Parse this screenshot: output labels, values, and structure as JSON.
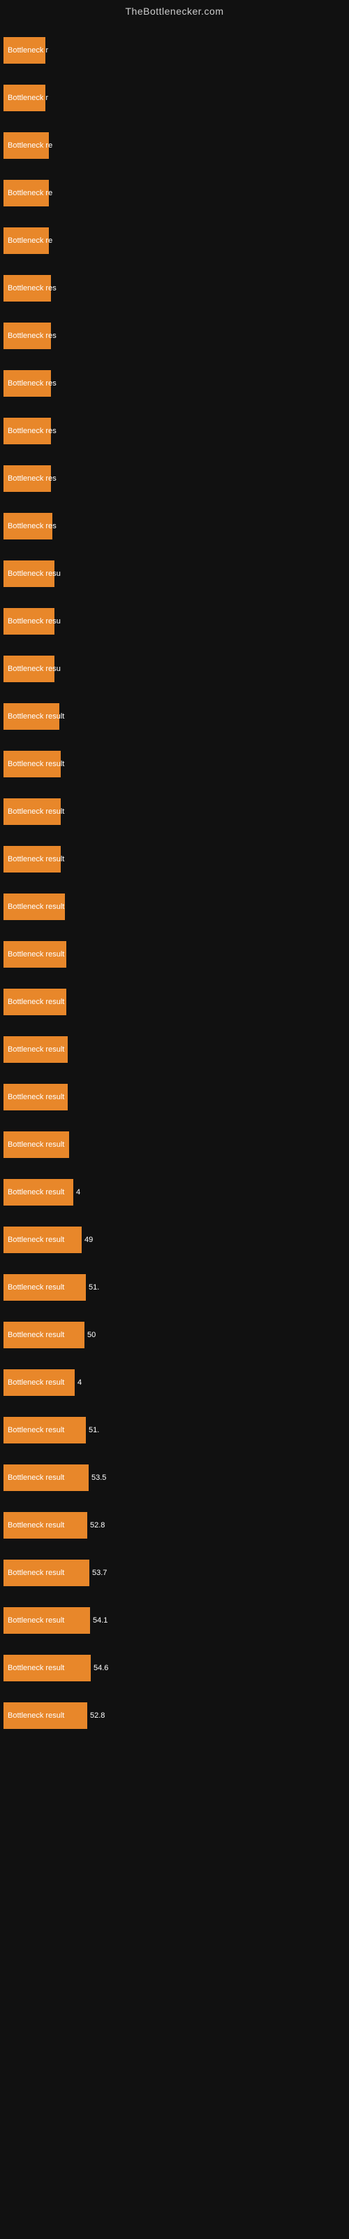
{
  "header": {
    "title": "TheBottlenecker.com"
  },
  "bars": [
    {
      "label": "Bottleneck r",
      "width": 60,
      "value": ""
    },
    {
      "label": "Bottleneck r",
      "width": 60,
      "value": ""
    },
    {
      "label": "Bottleneck re",
      "width": 65,
      "value": ""
    },
    {
      "label": "Bottleneck re",
      "width": 65,
      "value": ""
    },
    {
      "label": "Bottleneck re",
      "width": 65,
      "value": ""
    },
    {
      "label": "Bottleneck res",
      "width": 68,
      "value": ""
    },
    {
      "label": "Bottleneck res",
      "width": 68,
      "value": ""
    },
    {
      "label": "Bottleneck res",
      "width": 68,
      "value": ""
    },
    {
      "label": "Bottleneck res",
      "width": 68,
      "value": ""
    },
    {
      "label": "Bottleneck res",
      "width": 68,
      "value": ""
    },
    {
      "label": "Bottleneck res",
      "width": 70,
      "value": ""
    },
    {
      "label": "Bottleneck resu",
      "width": 73,
      "value": ""
    },
    {
      "label": "Bottleneck resu",
      "width": 73,
      "value": ""
    },
    {
      "label": "Bottleneck resu",
      "width": 73,
      "value": ""
    },
    {
      "label": "Bottleneck result",
      "width": 80,
      "value": ""
    },
    {
      "label": "Bottleneck result",
      "width": 82,
      "value": ""
    },
    {
      "label": "Bottleneck result",
      "width": 82,
      "value": ""
    },
    {
      "label": "Bottleneck result",
      "width": 82,
      "value": ""
    },
    {
      "label": "Bottleneck result",
      "width": 88,
      "value": ""
    },
    {
      "label": "Bottleneck result",
      "width": 90,
      "value": ""
    },
    {
      "label": "Bottleneck result",
      "width": 90,
      "value": ""
    },
    {
      "label": "Bottleneck result",
      "width": 92,
      "value": ""
    },
    {
      "label": "Bottleneck result",
      "width": 92,
      "value": ""
    },
    {
      "label": "Bottleneck result",
      "width": 94,
      "value": ""
    },
    {
      "label": "Bottleneck result",
      "width": 100,
      "value": "4"
    },
    {
      "label": "Bottleneck result",
      "width": 112,
      "value": "49"
    },
    {
      "label": "Bottleneck result",
      "width": 118,
      "value": "51."
    },
    {
      "label": "Bottleneck result",
      "width": 116,
      "value": "50"
    },
    {
      "label": "Bottleneck result",
      "width": 102,
      "value": "4"
    },
    {
      "label": "Bottleneck result",
      "width": 118,
      "value": "51."
    },
    {
      "label": "Bottleneck result",
      "width": 122,
      "value": "53.5"
    },
    {
      "label": "Bottleneck result",
      "width": 120,
      "value": "52.8"
    },
    {
      "label": "Bottleneck result",
      "width": 123,
      "value": "53.7"
    },
    {
      "label": "Bottleneck result",
      "width": 124,
      "value": "54.1"
    },
    {
      "label": "Bottleneck result",
      "width": 125,
      "value": "54.6"
    },
    {
      "label": "Bottleneck result",
      "width": 120,
      "value": "52.8"
    }
  ]
}
